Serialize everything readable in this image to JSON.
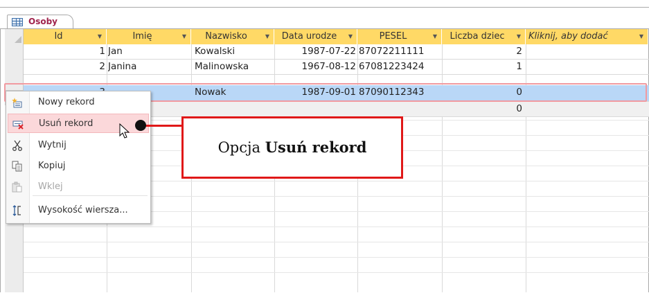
{
  "tab": {
    "label": "Osoby"
  },
  "columns": [
    {
      "label": "Id"
    },
    {
      "label": "Imię"
    },
    {
      "label": "Nazwisko"
    },
    {
      "label": "Data urodze"
    },
    {
      "label": "PESEL"
    },
    {
      "label": "Liczba dziec"
    },
    {
      "label": "Kliknij, aby dodać"
    }
  ],
  "rows": [
    {
      "id": "1",
      "imie": "Jan",
      "nazwisko": "Kowalski",
      "data": "1987-07-22",
      "pesel": "87072211111",
      "dzieci": "2"
    },
    {
      "id": "2",
      "imie": "Janina",
      "nazwisko": "Malinowska",
      "data": "1967-08-12",
      "pesel": "67081223424",
      "dzieci": "1"
    },
    {
      "id": "3",
      "imie": "",
      "nazwisko": "Nowak",
      "data": "1987-09-01",
      "pesel": "87090112343",
      "dzieci": "0"
    },
    {
      "id": "",
      "imie": "",
      "nazwisko": "",
      "data": "",
      "pesel": "",
      "dzieci": "0"
    }
  ],
  "context_menu": {
    "items": [
      {
        "label": "Nowy rekord",
        "icon": "new-record-icon",
        "state": "normal"
      },
      {
        "label": "Usuń rekord",
        "icon": "delete-record-icon",
        "state": "hover"
      },
      {
        "label": "Wytnij",
        "icon": "scissors-icon",
        "state": "normal"
      },
      {
        "label": "Kopiuj",
        "icon": "copy-icon",
        "state": "normal"
      },
      {
        "label": "Wklej",
        "icon": "paste-icon",
        "state": "disabled"
      },
      {
        "label": "Wysokość wiersza...",
        "icon": "row-height-icon",
        "state": "normal"
      }
    ]
  },
  "callout": {
    "prefix": "Opcja ",
    "bold": "Usuń rekord"
  },
  "colors": {
    "header_bg": "#ffd966",
    "selected_row": "#b9d7f7",
    "callout_border": "#e01818",
    "tab_text": "#a0234c"
  }
}
